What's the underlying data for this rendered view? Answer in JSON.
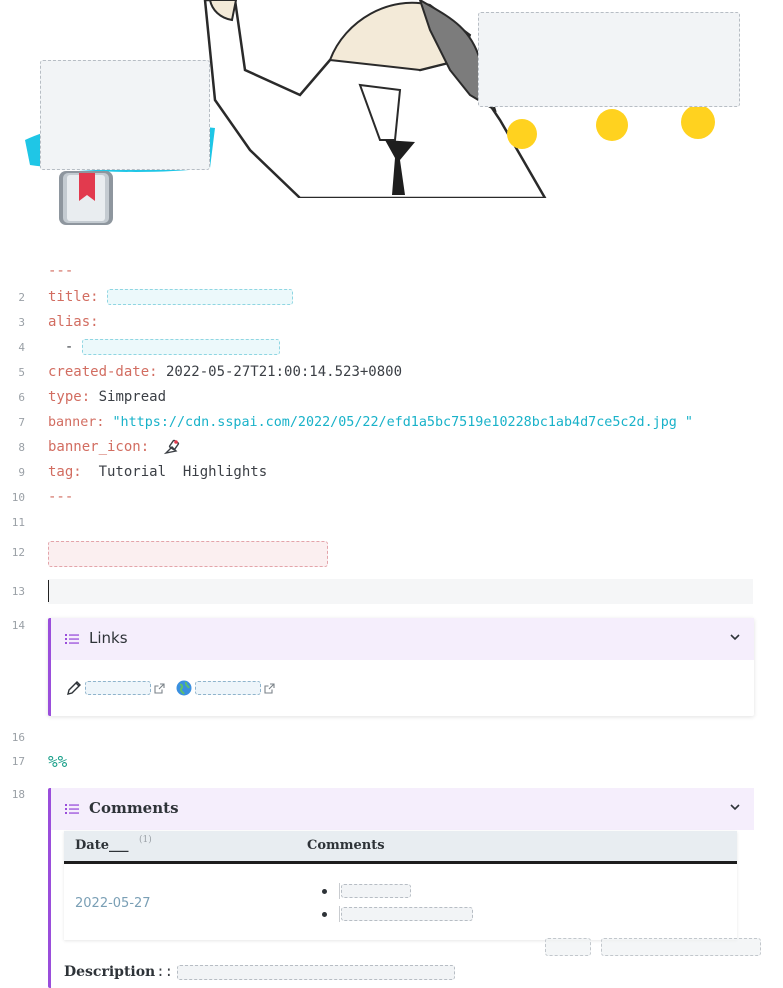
{
  "banner": {
    "title_left": "",
    "title_right": ""
  },
  "frontmatter": {
    "open_delim": "---",
    "close_delim": "---",
    "title_key": "title:",
    "title_value": "",
    "alias_key": "alias:",
    "alias_dash": "  - ",
    "alias_value": "",
    "created_key": "created-date:",
    "created_value": " 2022-05-27T21:00:14.523+0800",
    "type_key": "type:",
    "type_value": " Simpread",
    "banner_key": "banner:",
    "banner_value": " \"https://cdn.sspai.com/2022/05/22/efd1a5bc7519e10228bc1ab4d7ce5c2d.jpg \"",
    "banner_icon_key": "banner_icon:",
    "tag_key": "tag:",
    "tag_value": "  Tutorial  Highlights"
  },
  "line_numbers": [
    "2",
    "3",
    "4",
    "5",
    "6",
    "7",
    "8",
    "9",
    "10",
    "11",
    "12",
    "13",
    "14",
    "16",
    "17",
    "18"
  ],
  "heading": "",
  "links_callout": {
    "title": "Links",
    "internal_link": "",
    "external_link": ""
  },
  "percent_marker": "%%",
  "comments_callout": {
    "title": "Comments",
    "table": {
      "headers": [
        "Date___",
        "Comments"
      ],
      "header_footnote": "(1)",
      "rows": [
        {
          "date": "2022-05-27",
          "comments": [
            "",
            ""
          ]
        }
      ]
    },
    "description_label": "Description",
    "description_sep": "::",
    "description_value": ""
  },
  "watermark": {
    "site": "",
    "author": ""
  },
  "colors": {
    "key": "#d26d61",
    "string": "#19b2c9",
    "heading": "#d35a68",
    "callout_accent": "#9a4edb",
    "callout_header_bg": "#f5eefc",
    "link": "#6a93ad",
    "percent": "#1aa08a"
  }
}
